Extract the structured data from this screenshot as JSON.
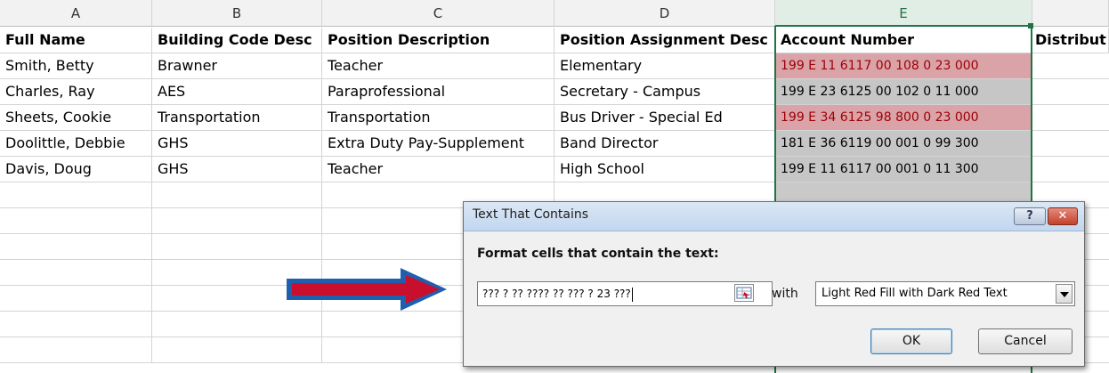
{
  "columns": [
    "A",
    "B",
    "C",
    "D",
    "E",
    ""
  ],
  "headers": [
    "Full Name",
    "Building Code Desc",
    "Position Description",
    "Position Assignment Desc",
    "Account Number",
    "Distribut"
  ],
  "rows": [
    [
      "Smith, Betty",
      "Brawner",
      "Teacher",
      "Elementary",
      "199 E 11 6117 00 108 0 23 000"
    ],
    [
      "Charles, Ray",
      "AES",
      "Paraprofessional",
      "Secretary - Campus",
      "199 E 23 6125 00 102 0 11 000"
    ],
    [
      "Sheets, Cookie",
      "Transportation",
      "Transportation",
      "Bus Driver - Special Ed",
      "199 E 34 6125 98 800 0 23 000"
    ],
    [
      "Doolittle, Debbie",
      "GHS",
      "Extra Duty Pay-Supplement",
      "Band Director",
      "181 E 36 6119 00 001 0 99 300"
    ],
    [
      "Davis, Doug",
      "GHS",
      "Teacher",
      "High School",
      "199 E 11 6117 00 001 0 11 300"
    ]
  ],
  "highlighted_rows": [
    0,
    2
  ],
  "colors": {
    "highlight_fill": "#d9a3a8",
    "highlight_text": "#9c0006",
    "selected_fill": "#c6c6c6",
    "excel_green": "#217346",
    "arrow_red": "#c8102e",
    "arrow_blue": "#1f5fb0"
  },
  "dialog": {
    "title": "Text That Contains",
    "help_label": "?",
    "close_label": "✕",
    "prompt": "Format cells that contain the text:",
    "input_value": "??? ? ?? ???? ?? ??? ? 23 ???",
    "with_label": "with",
    "format_option": "Light Red Fill with Dark Red Text",
    "ok_label": "OK",
    "cancel_label": "Cancel"
  },
  "icons": {
    "range_selector": "range-selector-icon",
    "dropdown": "chevron-down-icon",
    "pointer_arrow": "arrow-right-icon"
  }
}
